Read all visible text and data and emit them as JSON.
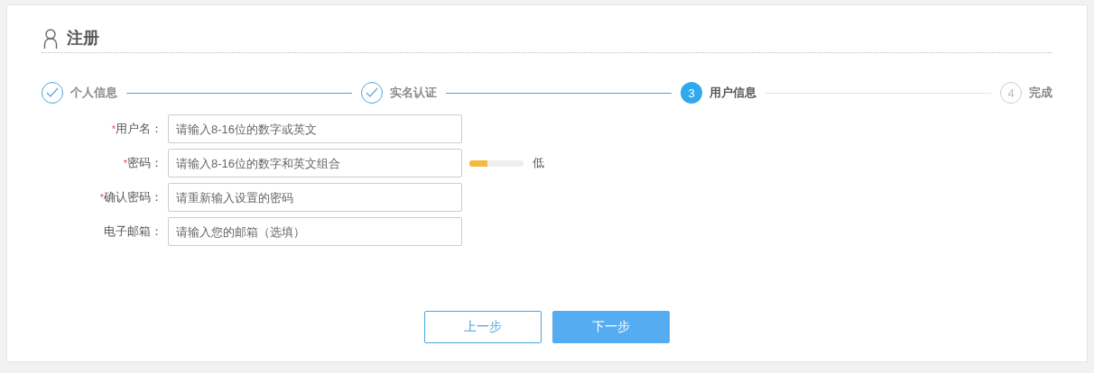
{
  "title": "注册",
  "steps": [
    {
      "label": "个人信息",
      "kind": "done"
    },
    {
      "label": "实名认证",
      "kind": "done"
    },
    {
      "number": "3",
      "label": "用户信息",
      "kind": "current"
    },
    {
      "number": "4",
      "label": "完成",
      "kind": "todo"
    }
  ],
  "required_mark": "*",
  "fields": [
    {
      "label": "用户名：",
      "placeholder": "请输入8-16位的数字或英文",
      "required": true
    },
    {
      "label": "密码：",
      "placeholder": "请输入8-16位的数字和英文组合",
      "required": true,
      "strength": {
        "level": 0.33,
        "reading": "低"
      }
    },
    {
      "label": "确认密码：",
      "placeholder": "请重新输入设置的密码",
      "required": true
    },
    {
      "label": "电子邮箱：",
      "placeholder": "请输入您的邮箱（选填）",
      "required": false
    }
  ],
  "buttons": [
    {
      "label": "上一步",
      "kind": "secondary"
    },
    {
      "label": "下一步",
      "kind": "primary"
    }
  ]
}
